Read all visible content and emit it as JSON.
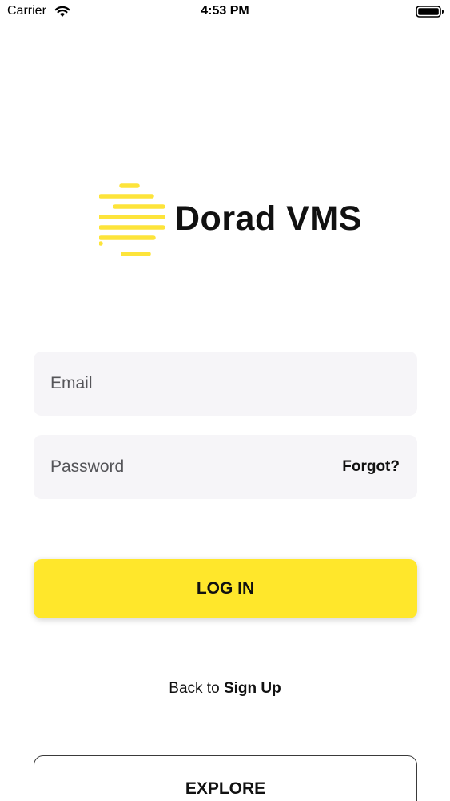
{
  "status_bar": {
    "carrier": "Carrier",
    "time": "4:53 PM",
    "wifi_icon": "wifi-icon",
    "battery_icon": "battery-full-icon"
  },
  "logo": {
    "text": "Dorad VMS",
    "mark_icon": "dorad-logo-mark",
    "mark_color": "#fde43a"
  },
  "form": {
    "email_placeholder": "Email",
    "email_value": "",
    "password_placeholder": "Password",
    "password_value": "",
    "forgot_label": "Forgot?",
    "login_label": "LOG IN"
  },
  "footer": {
    "back_prefix": "Back to",
    "signup_label": "Sign Up",
    "explore_label": "EXPLORE"
  },
  "colors": {
    "accent": "#ffe72b",
    "field_bg": "#f6f5f8",
    "text": "#111111"
  }
}
